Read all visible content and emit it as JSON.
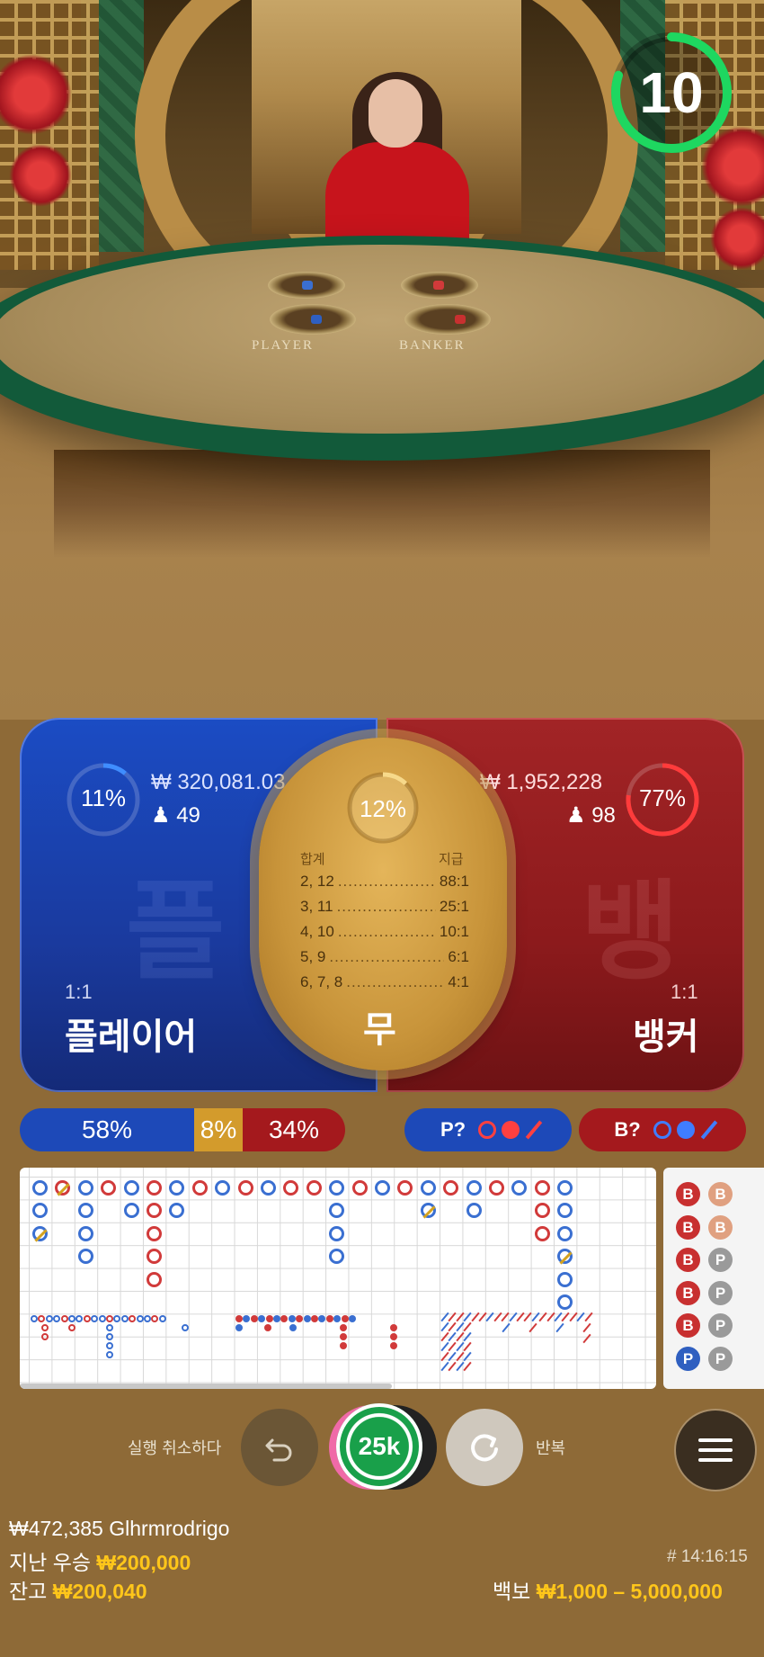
{
  "table": {
    "player_label": "PLAYER",
    "banker_label": "BANKER"
  },
  "timer": {
    "value": "10",
    "fraction_remaining": 0.8
  },
  "player": {
    "percent": "11%",
    "amount": "₩ 320,081.03",
    "users": "49",
    "odds": "1:1",
    "title": "플레이어"
  },
  "tie": {
    "percent": "12%",
    "head_total": "합계",
    "head_pay": "지급",
    "rows": [
      {
        "sum": "2, 12",
        "pay": "88:1"
      },
      {
        "sum": "3, 11",
        "pay": "25:1"
      },
      {
        "sum": "4, 10",
        "pay": "10:1"
      },
      {
        "sum": "5, 9",
        "pay": "6:1"
      },
      {
        "sum": "6, 7, 8",
        "pay": "4:1"
      }
    ],
    "title": "무"
  },
  "banker": {
    "percent": "77%",
    "amount": "₩ 1,952,228",
    "users": "98",
    "odds": "1:1",
    "title": "뱅커"
  },
  "stats": {
    "player_pct": "58%",
    "tie_pct": "8%",
    "banker_pct": "34%"
  },
  "predict": {
    "player_label": "P?",
    "banker_label": "B?"
  },
  "bead_road_side": [
    [
      "B",
      "B"
    ],
    [
      "B",
      "B"
    ],
    [
      "B",
      "P"
    ],
    [
      "B",
      "P"
    ],
    [
      "B",
      "P"
    ],
    [
      "P",
      "P"
    ]
  ],
  "controls": {
    "undo_label": "실행 취소하다",
    "chip_value": "25k",
    "repeat_label": "반복"
  },
  "footer": {
    "balance_user": "₩472,385 Glhrmrodrigo",
    "last_win_label": "지난 우승",
    "last_win_value": "₩200,000",
    "balance_label": "잔고",
    "balance_value": "₩200,040",
    "round_id": "# 14:16:15",
    "limits_label": "백보",
    "limits_value": "₩1,000 – 5,000,000"
  },
  "colors": {
    "player_blue": "#1b4cc4",
    "banker_red": "#a22426",
    "tie_gold": "#c8943a",
    "accent_yellow": "#ffc61a",
    "timer_green": "#1ed760"
  }
}
